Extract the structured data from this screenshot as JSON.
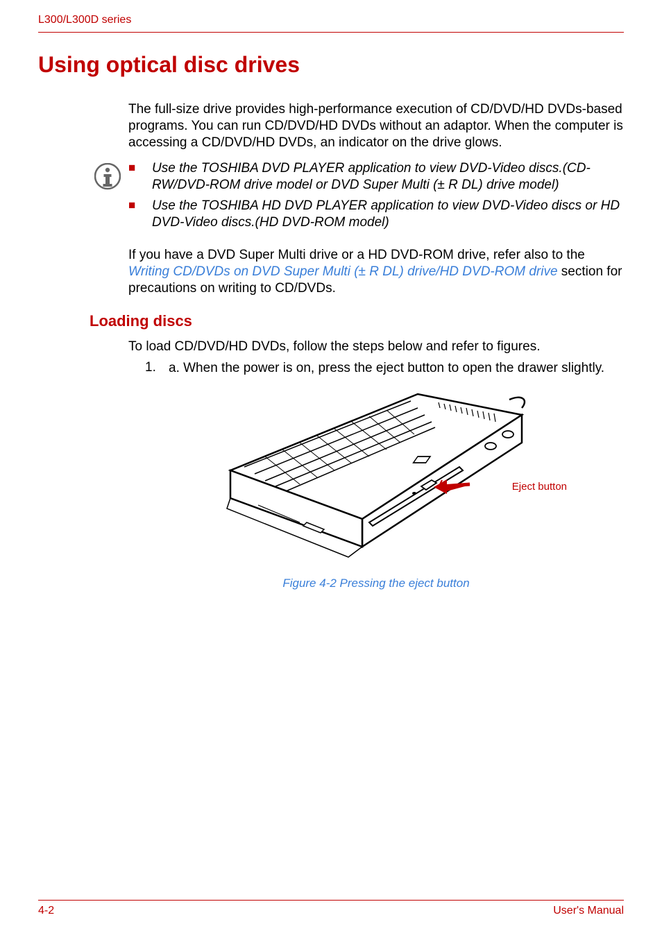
{
  "header": {
    "running": "L300/L300D series"
  },
  "section": {
    "title": "Using optical disc drives",
    "intro": "The full-size drive provides high-performance execution of CD/DVD/HD DVDs-based programs. You can run CD/DVD/HD DVDs without an adaptor. When the computer is accessing a CD/DVD/HD DVDs, an indicator on the drive glows."
  },
  "note": {
    "items": [
      "Use the TOSHIBA DVD PLAYER application to view DVD-Video discs.(CD-RW/DVD-ROM drive model or DVD Super Multi (± R DL) drive model)",
      "Use the TOSHIBA HD DVD PLAYER application to view DVD-Video discs or HD DVD-Video discs.(HD DVD-ROM model)"
    ]
  },
  "cross_ref": {
    "before": "If you have a DVD Super Multi drive or a HD DVD-ROM drive, refer also to the ",
    "link": "Writing CD/DVDs on DVD Super Multi (± R DL) drive/HD DVD-ROM drive",
    "after": " section for precautions on writing to CD/DVDs."
  },
  "subsection": {
    "title": "Loading discs",
    "intro": "To load CD/DVD/HD DVDs, follow the steps below and refer to figures.",
    "step1_num": "1.",
    "step1_body": "a. When the power is on, press the eject button to open the drawer slightly."
  },
  "figure": {
    "callout": "Eject button",
    "caption": "Figure 4-2 Pressing the eject button"
  },
  "footer": {
    "page": "4-2",
    "doc": "User's Manual"
  }
}
